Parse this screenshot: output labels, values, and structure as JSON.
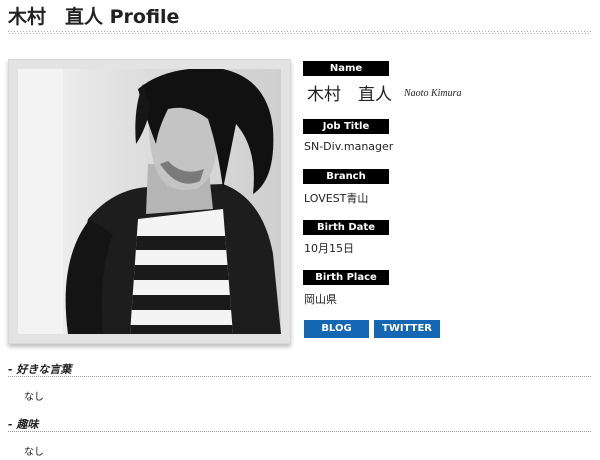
{
  "profile": {
    "title": "木村　直人 Profile"
  },
  "photo": {
    "subject": "person-portrait"
  },
  "fields": {
    "name_label": "Name",
    "name_ja": "木村　直人",
    "name_en": "Naoto Kimura",
    "job_title_label": "Job Title",
    "job_title": "SN-Div.manager",
    "branch_label": "Branch",
    "branch": "LOVEST青山",
    "birth_date_label": "Birth Date",
    "birth_date": "10月15日",
    "birth_place_label": "Birth Place",
    "birth_place": "岡山県"
  },
  "buttons": {
    "blog": "BLOG",
    "twitter": "TWITTER"
  },
  "sections": [
    {
      "heading": "- 好きな言葉",
      "body": "なし"
    },
    {
      "heading": "- 趣味",
      "body": "なし"
    }
  ],
  "colors": {
    "label_bg": "#000000",
    "button_bg": "#1467b3",
    "text": "#222222"
  }
}
